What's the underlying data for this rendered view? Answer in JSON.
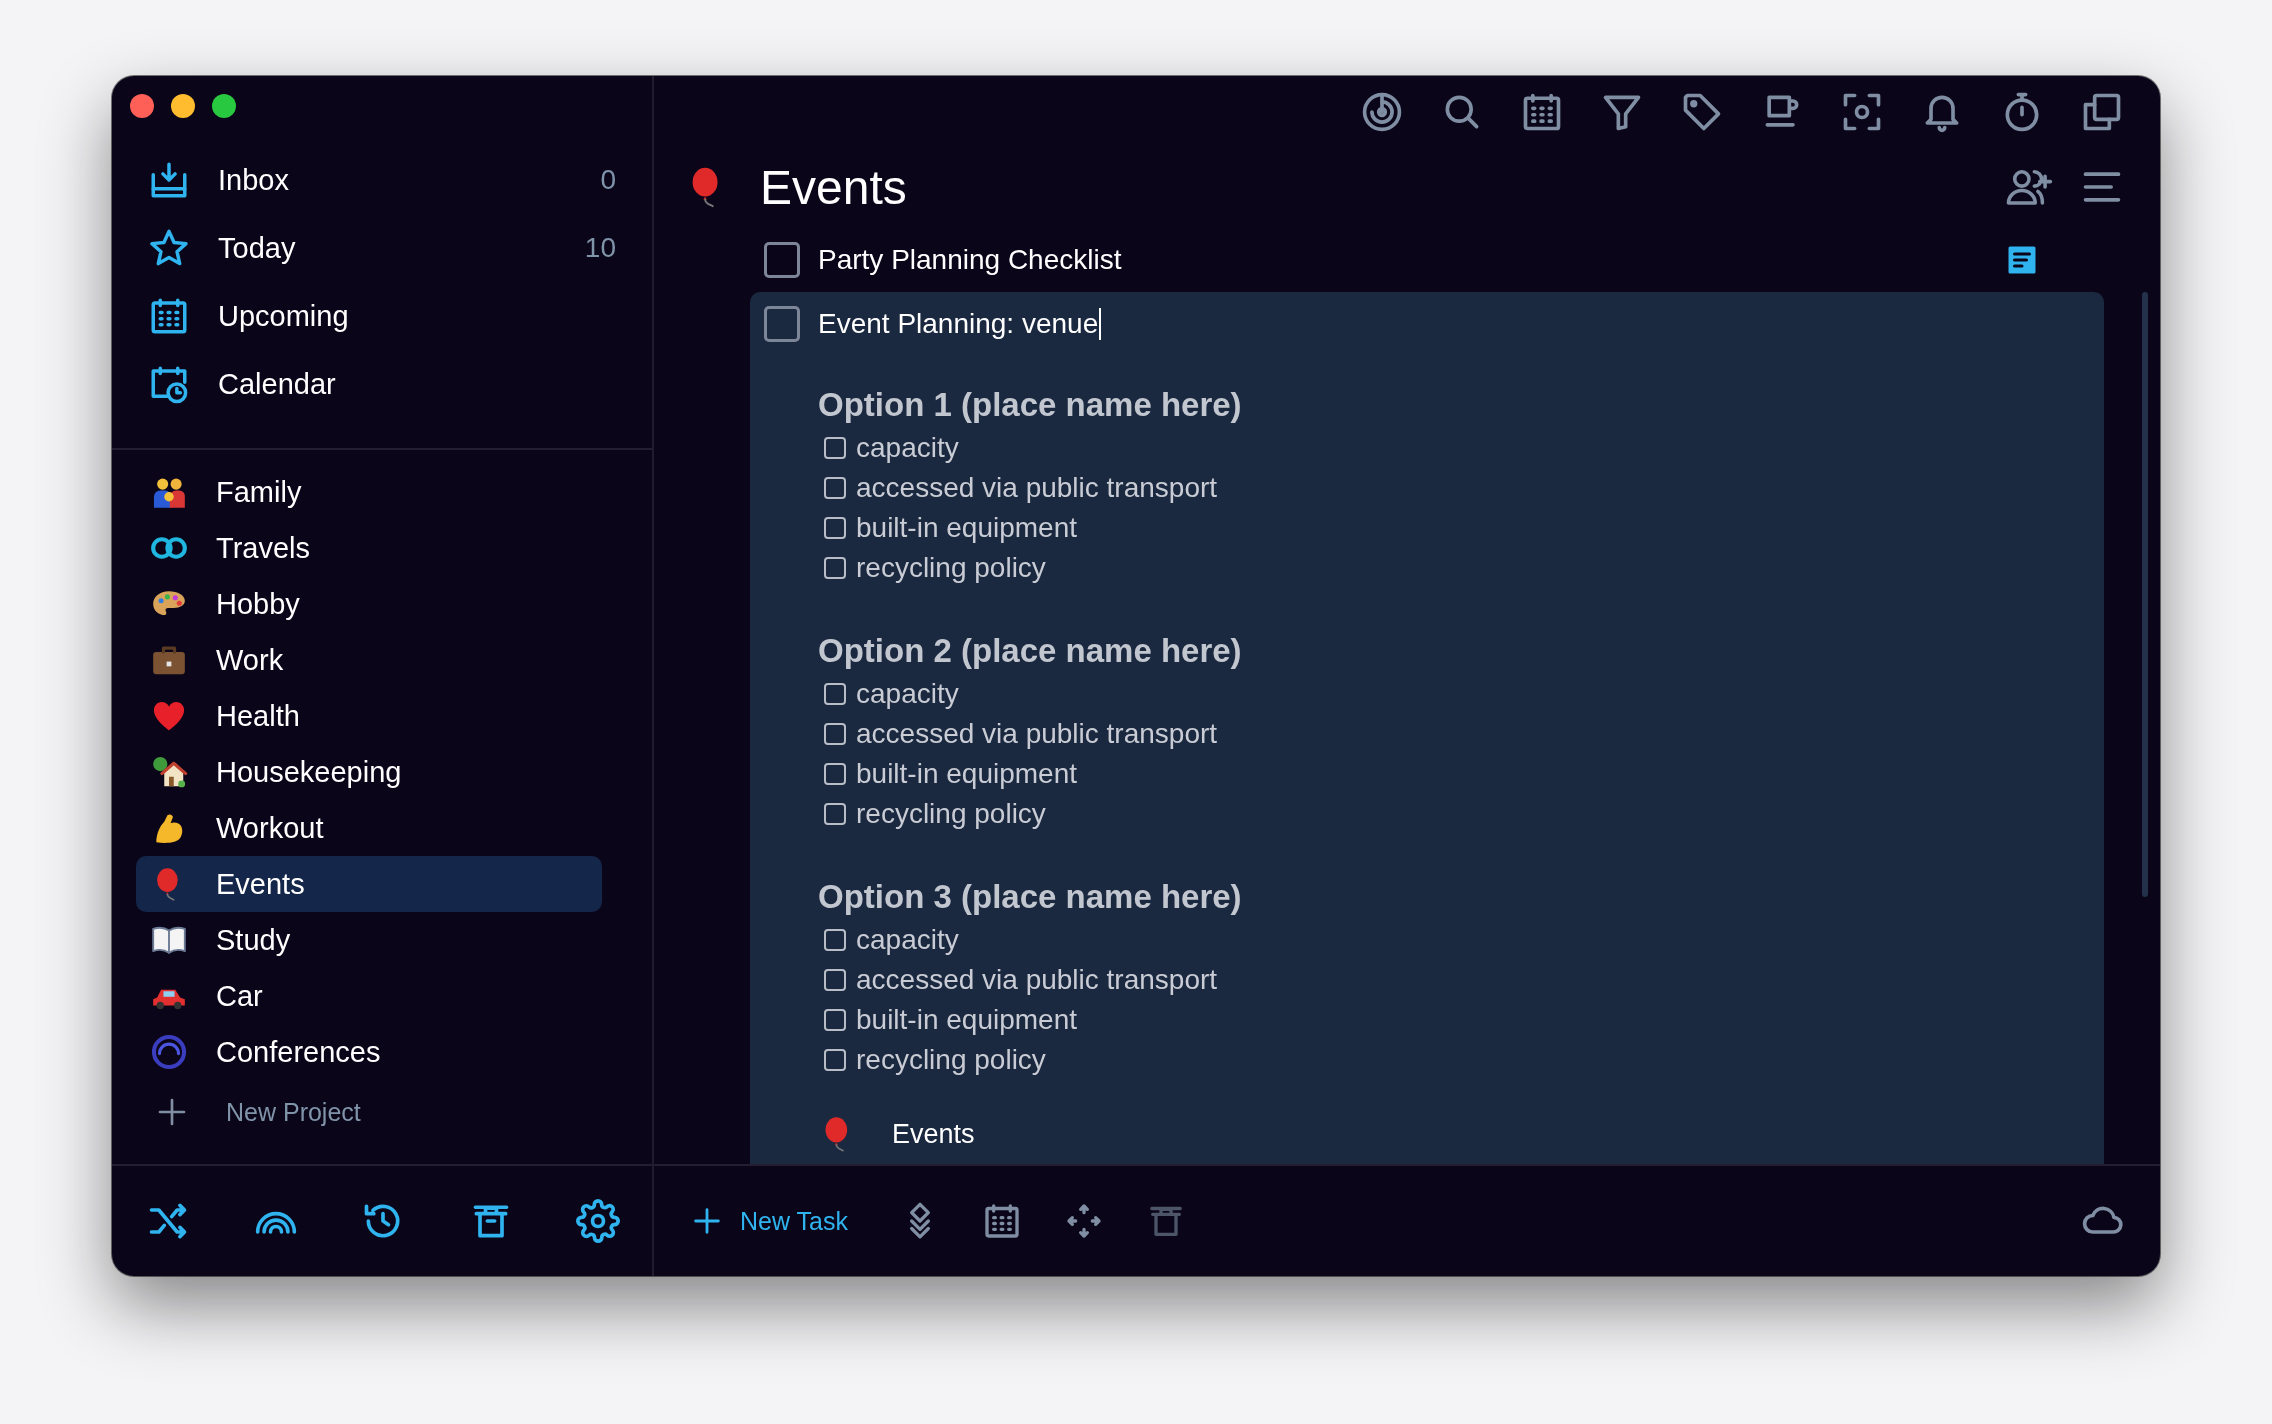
{
  "sidebar": {
    "smart_lists": [
      {
        "label": "Inbox",
        "count": "0"
      },
      {
        "label": "Today",
        "count": "10"
      },
      {
        "label": "Upcoming"
      },
      {
        "label": "Calendar"
      }
    ],
    "projects": [
      {
        "label": "Family",
        "selected": false
      },
      {
        "label": "Travels",
        "selected": false
      },
      {
        "label": "Hobby",
        "selected": false
      },
      {
        "label": "Work",
        "selected": false
      },
      {
        "label": "Health",
        "selected": false
      },
      {
        "label": "Housekeeping",
        "selected": false
      },
      {
        "label": "Workout",
        "selected": false
      },
      {
        "label": "Events",
        "selected": true
      },
      {
        "label": "Study",
        "selected": false
      },
      {
        "label": "Car",
        "selected": false
      },
      {
        "label": "Conferences",
        "selected": false
      }
    ],
    "new_project": "New Project"
  },
  "main": {
    "title": "Events",
    "tasks": [
      {
        "title": "Party Planning Checklist",
        "checked": false,
        "has_note": true,
        "expanded": false
      },
      {
        "title": "Event Planning: venue",
        "checked": false,
        "has_note": false,
        "expanded": true,
        "editing": true,
        "sections": [
          {
            "heading": "Option 1 (place name here)",
            "items": [
              {
                "text": "capacity",
                "checked": false
              },
              {
                "text": "accessed via public transport",
                "checked": false
              },
              {
                "text": "built-in equipment",
                "checked": false
              },
              {
                "text": "recycling policy",
                "checked": false
              }
            ]
          },
          {
            "heading": "Option 2 (place name here)",
            "items": [
              {
                "text": "capacity",
                "checked": false
              },
              {
                "text": "accessed via public transport",
                "checked": false
              },
              {
                "text": "built-in equipment",
                "checked": false
              },
              {
                "text": "recycling policy",
                "checked": false
              }
            ]
          },
          {
            "heading": "Option 3 (place name here)",
            "items": [
              {
                "text": "capacity",
                "checked": false
              },
              {
                "text": "accessed via public transport",
                "checked": false
              },
              {
                "text": "built-in equipment",
                "checked": false
              },
              {
                "text": "recycling policy",
                "checked": false
              }
            ]
          }
        ],
        "project_link": "Events"
      }
    ],
    "new_task": "New Task"
  }
}
